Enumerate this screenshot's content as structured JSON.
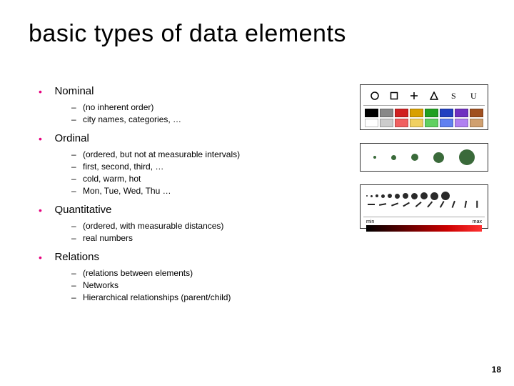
{
  "title": "basic types of data elements",
  "page_number": "18",
  "items": [
    {
      "label": "Nominal",
      "subs": [
        "(no inherent order)",
        "city names, categories, …"
      ]
    },
    {
      "label": "Ordinal",
      "subs": [
        "(ordered, but not at measurable intervals)",
        "first, second, third, …",
        "cold, warm, hot",
        "Mon, Tue, Wed, Thu …"
      ]
    },
    {
      "label": "Quantitative",
      "subs": [
        "(ordered, with measurable distances)",
        "real numbers"
      ]
    },
    {
      "label": "Relations",
      "subs": [
        "(relations between elements)",
        "Networks",
        "Hierarchical relationships (parent/child)"
      ]
    }
  ],
  "fig1": {
    "swatches": [
      "#000000",
      "#888888",
      "#d02020",
      "#d8a000",
      "#20a020",
      "#2040c0",
      "#7030c0",
      "#a05020",
      "#ffffff",
      "#cccccc",
      "#f06060",
      "#f0d060",
      "#60d060",
      "#6080f0",
      "#b080f0",
      "#d0a070"
    ]
  },
  "fig2": {
    "sizes": [
      4,
      7,
      10,
      15,
      22
    ]
  },
  "fig3": {
    "dot_sizes": [
      2,
      3,
      4,
      5,
      6,
      7,
      8,
      9,
      10,
      11,
      12
    ],
    "tick_angles": [
      0,
      10,
      20,
      30,
      40,
      50,
      60,
      70,
      80,
      90
    ],
    "min_label": "min",
    "max_label": "max"
  }
}
